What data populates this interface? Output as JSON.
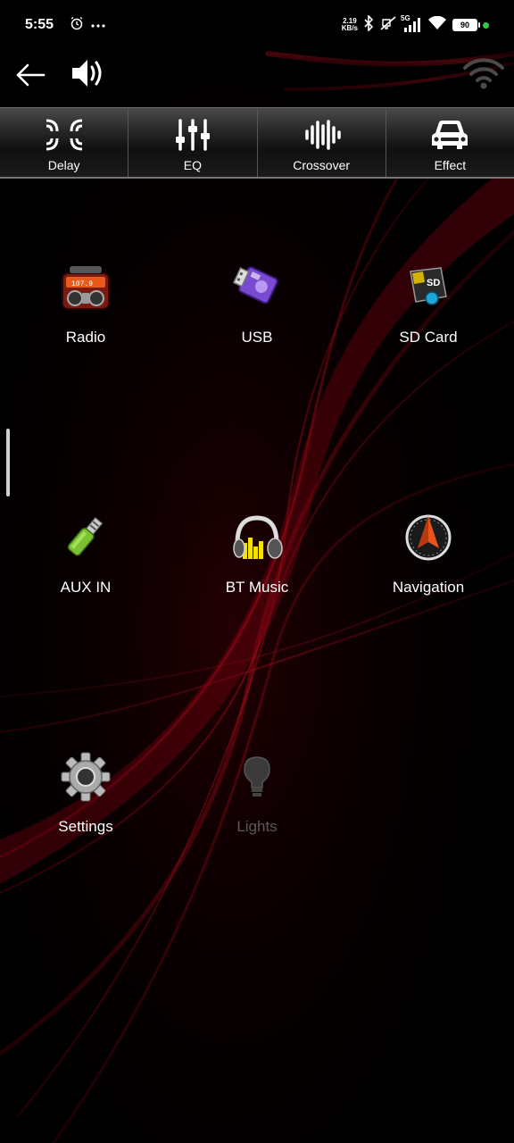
{
  "status": {
    "time": "5:55",
    "netspeed_value": "2.19",
    "netspeed_unit": "KB/s",
    "network": "5G",
    "battery": "90",
    "icons": [
      "alarm-icon",
      "more-dots-icon",
      "bluetooth-icon",
      "mute-icon",
      "signal-icon",
      "wifi-icon",
      "battery-icon"
    ]
  },
  "topbar": {
    "back": "back-arrow-icon",
    "volume": "speaker-icon",
    "wifi": "wifi-icon"
  },
  "toolbar": {
    "items": [
      {
        "label": "Delay",
        "icon": "delay-icon"
      },
      {
        "label": "EQ",
        "icon": "equalizer-icon"
      },
      {
        "label": "Crossover",
        "icon": "crossover-icon"
      },
      {
        "label": "Effect",
        "icon": "car-icon"
      }
    ]
  },
  "apps": [
    {
      "label": "Radio",
      "icon": "radio-icon",
      "enabled": true
    },
    {
      "label": "USB",
      "icon": "usb-icon",
      "enabled": true
    },
    {
      "label": "SD Card",
      "icon": "sd-card-icon",
      "enabled": true
    },
    {
      "label": "AUX IN",
      "icon": "aux-jack-icon",
      "enabled": true
    },
    {
      "label": "BT Music",
      "icon": "headphones-icon",
      "enabled": true
    },
    {
      "label": "Navigation",
      "icon": "compass-icon",
      "enabled": true
    },
    {
      "label": "Settings",
      "icon": "gear-icon",
      "enabled": true
    },
    {
      "label": "Lights",
      "icon": "lightbulb-icon",
      "enabled": false
    }
  ],
  "colors": {
    "background": "#000000",
    "swoosh": "#b00010",
    "disabled_text": "#5a5a5a",
    "battery_dot": "#2ecc40"
  }
}
